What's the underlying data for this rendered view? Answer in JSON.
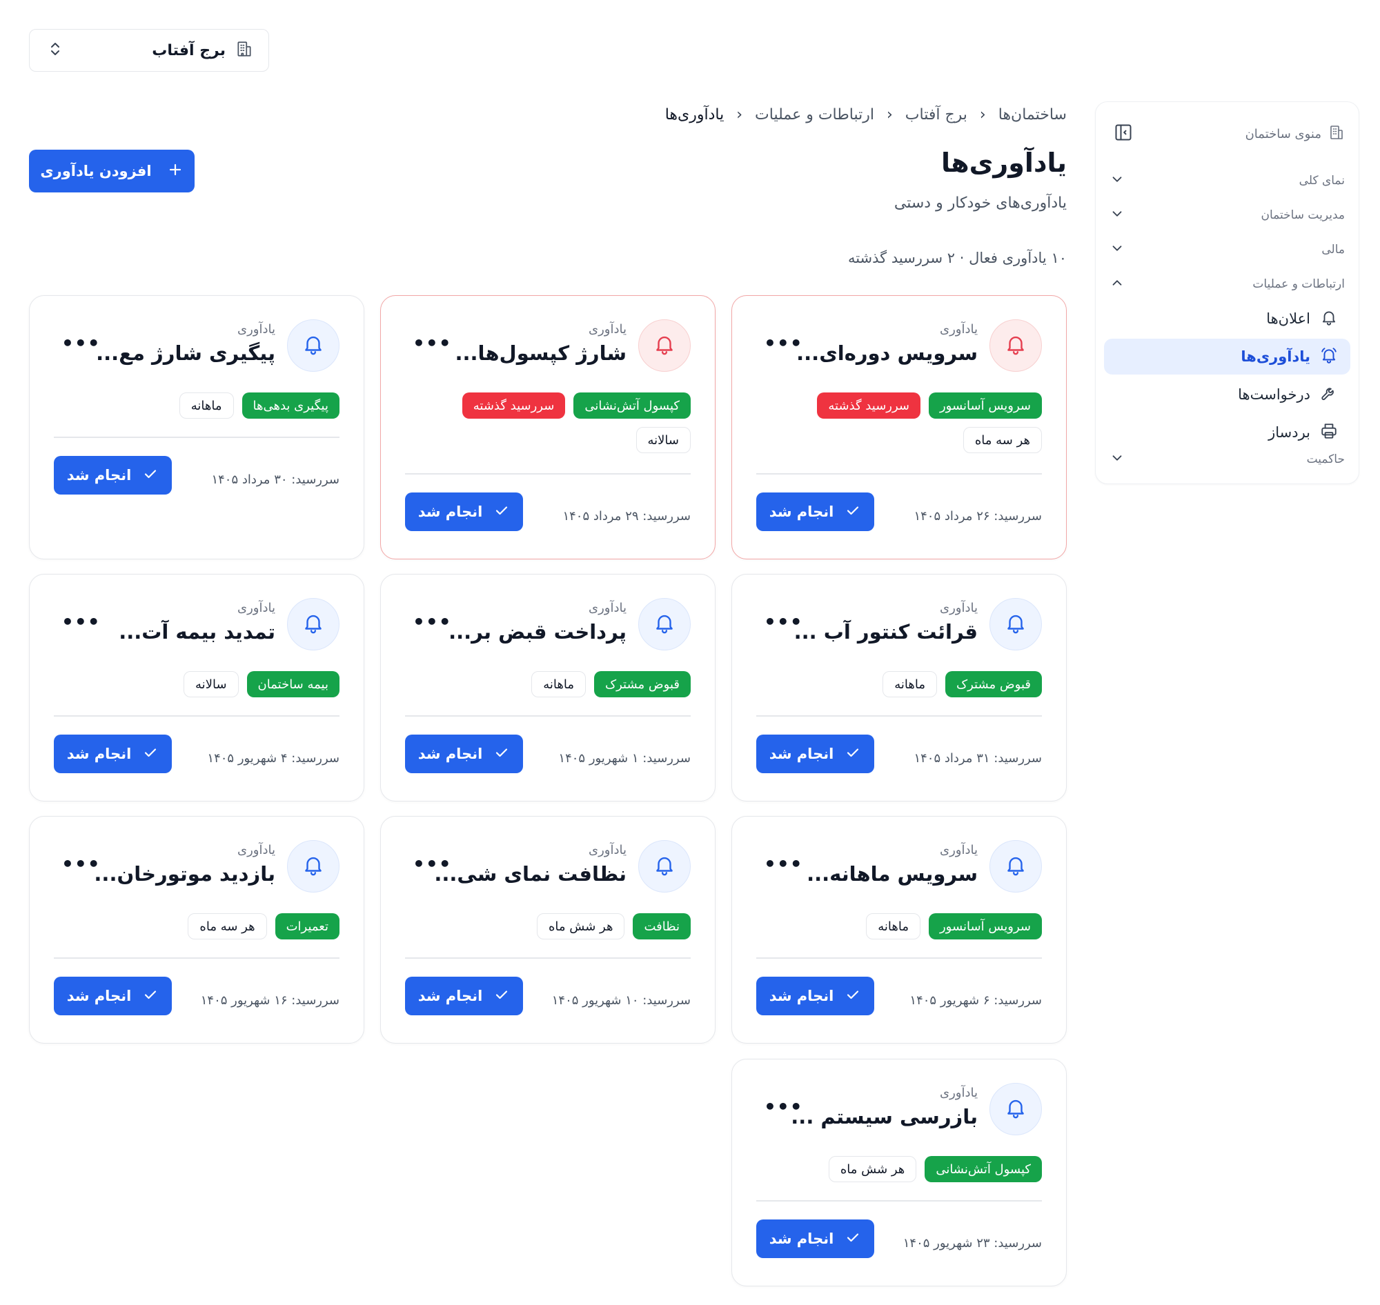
{
  "building_selector": {
    "name": "برج آفتاب"
  },
  "sidebar": {
    "title": "منوی ساختمان",
    "sections": [
      {
        "label": "نمای کلی",
        "expanded": false
      },
      {
        "label": "مدیریت ساختمان",
        "expanded": false
      },
      {
        "label": "مالی",
        "expanded": false
      },
      {
        "label": "ارتباطات و عملیات",
        "expanded": true
      },
      {
        "label": "حاکمیت",
        "expanded": false
      }
    ],
    "items": [
      {
        "label": "اعلان‌ها",
        "icon": "bell-icon",
        "active": false
      },
      {
        "label": "یادآوری‌ها",
        "icon": "bell-ring-icon",
        "active": true
      },
      {
        "label": "درخواست‌ها",
        "icon": "wrench-icon",
        "active": false
      },
      {
        "label": "بردساز",
        "icon": "printer-icon",
        "active": false
      }
    ]
  },
  "breadcrumb": [
    "ساختمان‌ها",
    "برج آفتاب",
    "ارتباطات و عملیات",
    "یادآوری‌ها"
  ],
  "header": {
    "title": "یادآوری‌ها",
    "subtitle": "یادآوری‌های خودکار و دستی",
    "stats": "۱۰ یادآوری فعال · ۲ سررسید گذشته",
    "add_button": "افزودن یادآوری"
  },
  "card_common": {
    "kind": "یادآوری",
    "done_label": "انجام شد"
  },
  "reminders": [
    {
      "title": "سرویس دوره‌ای...",
      "overdue": true,
      "tags": [
        {
          "text": "سرویس آسانسور",
          "style": "green"
        },
        {
          "text": "سررسید گذشته",
          "style": "red"
        },
        {
          "text": "هر سه ماه",
          "style": "outline"
        }
      ],
      "due": "سررسید: ۲۶ مرداد ۱۴۰۵"
    },
    {
      "title": "شارژ کپسول‌ها...",
      "overdue": true,
      "tags": [
        {
          "text": "کپسول آتش‌نشانی",
          "style": "green"
        },
        {
          "text": "سررسید گذشته",
          "style": "red"
        },
        {
          "text": "سالانه",
          "style": "outline"
        }
      ],
      "due": "سررسید: ۲۹ مرداد ۱۴۰۵"
    },
    {
      "title": "پیگیری شارژ مع...",
      "overdue": false,
      "tags": [
        {
          "text": "پیگیری بدهی‌ها",
          "style": "green"
        },
        {
          "text": "ماهانه",
          "style": "outline"
        }
      ],
      "due": "سررسید: ۳۰ مرداد ۱۴۰۵"
    },
    {
      "title": "قرائت کنتور آب ...",
      "overdue": false,
      "tags": [
        {
          "text": "قبوض مشترک",
          "style": "green"
        },
        {
          "text": "ماهانه",
          "style": "outline"
        }
      ],
      "due": "سررسید: ۳۱ مرداد ۱۴۰۵"
    },
    {
      "title": "پرداخت قبض بر...",
      "overdue": false,
      "tags": [
        {
          "text": "قبوض مشترک",
          "style": "green"
        },
        {
          "text": "ماهانه",
          "style": "outline"
        }
      ],
      "due": "سررسید: ۱ شهریور ۱۴۰۵"
    },
    {
      "title": "تمدید بیمه آت...",
      "overdue": false,
      "tags": [
        {
          "text": "بیمه ساختمان",
          "style": "green"
        },
        {
          "text": "سالانه",
          "style": "outline"
        }
      ],
      "due": "سررسید: ۴ شهریور ۱۴۰۵"
    },
    {
      "title": "سرویس ماهانه...",
      "overdue": false,
      "tags": [
        {
          "text": "سرویس آسانسور",
          "style": "green"
        },
        {
          "text": "ماهانه",
          "style": "outline"
        }
      ],
      "due": "سررسید: ۶ شهریور ۱۴۰۵"
    },
    {
      "title": "نظافت نمای شی...",
      "overdue": false,
      "tags": [
        {
          "text": "نظافت",
          "style": "green"
        },
        {
          "text": "هر شش ماه",
          "style": "outline"
        }
      ],
      "due": "سررسید: ۱۰ شهریور ۱۴۰۵"
    },
    {
      "title": "بازدید موتورخان...",
      "overdue": false,
      "tags": [
        {
          "text": "تعمیرات",
          "style": "green"
        },
        {
          "text": "هر سه ماه",
          "style": "outline"
        }
      ],
      "due": "سررسید: ۱۶ شهریور ۱۴۰۵"
    },
    {
      "title": "بازرسی سیستم ...",
      "overdue": false,
      "tags": [
        {
          "text": "کپسول آتش‌نشانی",
          "style": "green"
        },
        {
          "text": "هر شش ماه",
          "style": "outline"
        }
      ],
      "due": "سررسید: ۲۳ شهریور ۱۴۰۵"
    }
  ],
  "colors": {
    "primary": "#2563eb",
    "tag_green": "#16a34a",
    "tag_red": "#ef3340",
    "overdue_border": "#f2a6a6",
    "active_bg": "#e7efff"
  }
}
